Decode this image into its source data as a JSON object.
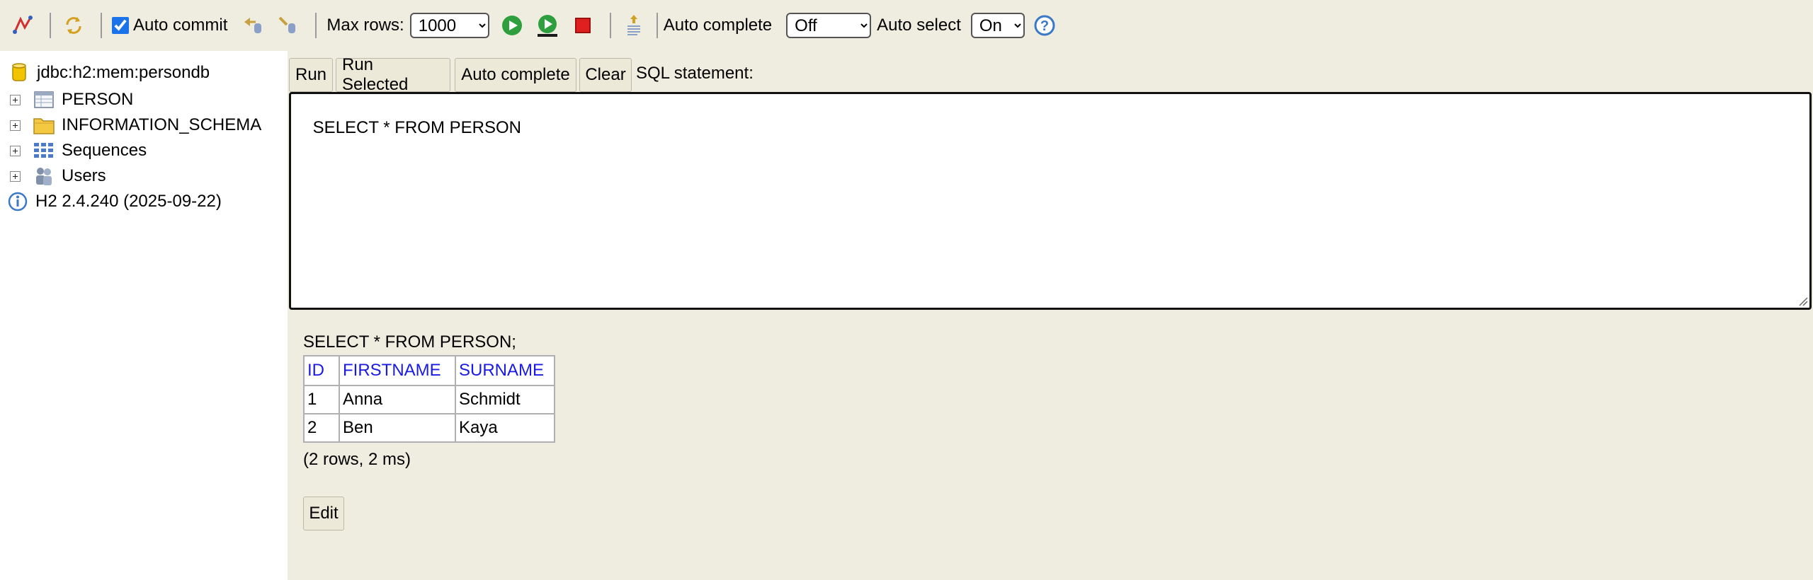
{
  "toolbar": {
    "auto_commit_label": "Auto commit",
    "auto_commit_checked": true,
    "max_rows_label": "Max rows:",
    "max_rows_value": "1000",
    "auto_complete_label": "Auto complete",
    "auto_complete_value": "Off",
    "auto_select_label": "Auto select",
    "auto_select_value": "On",
    "icons": [
      "disconnect-icon",
      "refresh-icon",
      "rollback-icon",
      "commit-icon",
      "run-icon",
      "run-selected-icon",
      "stop-icon",
      "history-icon",
      "help-icon"
    ]
  },
  "tree": {
    "connection": "jdbc:h2:mem:persondb",
    "items": [
      {
        "label": "PERSON",
        "icon": "table-icon"
      },
      {
        "label": "INFORMATION_SCHEMA",
        "icon": "folder-icon"
      },
      {
        "label": "Sequences",
        "icon": "sequences-icon"
      },
      {
        "label": "Users",
        "icon": "users-icon"
      }
    ],
    "version": "H2 2.4.240 (2025-09-22)"
  },
  "editor": {
    "buttons": {
      "run": "Run",
      "run_selected": "Run Selected",
      "auto_complete": "Auto complete",
      "clear": "Clear"
    },
    "sql_label": "SQL statement:",
    "sql_text": "SELECT * FROM PERSON"
  },
  "result": {
    "statement": "SELECT * FROM PERSON;",
    "columns": [
      "ID",
      "FIRSTNAME",
      "SURNAME"
    ],
    "rows": [
      [
        "1",
        "Anna",
        "Schmidt"
      ],
      [
        "2",
        "Ben",
        "Kaya"
      ]
    ],
    "summary": "(2 rows, 2 ms)",
    "edit_label": "Edit"
  },
  "colors": {
    "background": "#efece0",
    "header_link": "#1a1ae6",
    "run_green": "#2e9e3e",
    "stop_red": "#e02020"
  }
}
